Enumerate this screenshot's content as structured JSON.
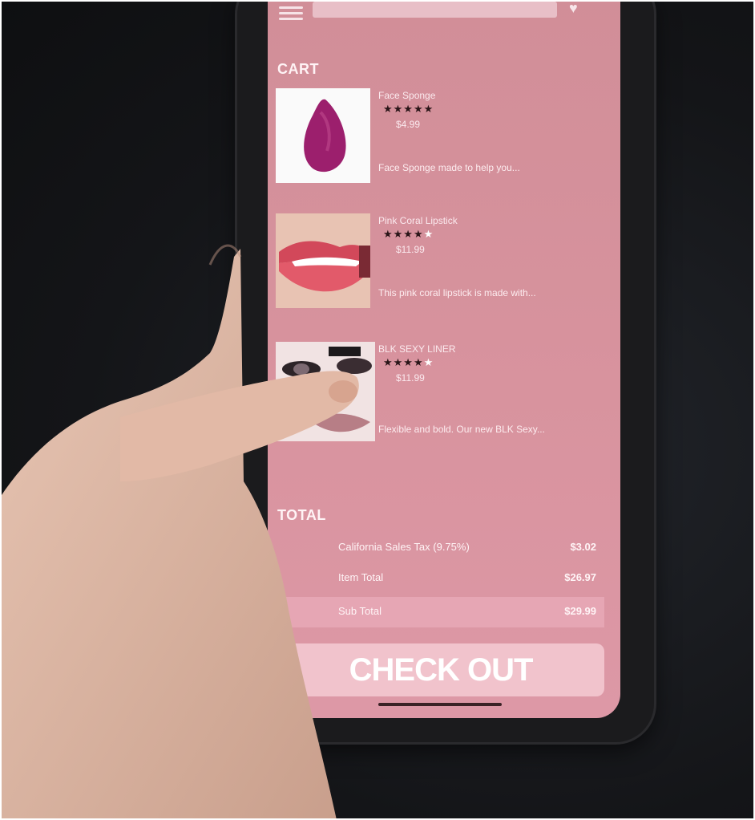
{
  "cart": {
    "title": "CART",
    "items": [
      {
        "name": "Face Sponge",
        "stars": "★★★★★",
        "empty_stars": "",
        "price": "$4.99",
        "description": "Face Sponge made to help you..."
      },
      {
        "name": "Pink Coral Lipstick",
        "stars": "★★★★",
        "empty_stars": "★",
        "price": "$11.99",
        "description": "This pink coral lipstick is made with..."
      },
      {
        "name": "BLK SEXY LINER",
        "stars": "★★★★",
        "empty_stars": "★",
        "price": "$11.99",
        "description": "Flexible and bold. Our new BLK Sexy..."
      }
    ]
  },
  "totals": {
    "title": "TOTAL",
    "rows": [
      {
        "label": "California Sales Tax (9.75%)",
        "value": "$3.02"
      },
      {
        "label": "Item Total",
        "value": "$26.97"
      },
      {
        "label": "Sub Total",
        "value": "$29.99"
      }
    ]
  },
  "checkout_label": "CHECK OUT",
  "icons": {
    "menu": "hamburger-menu-icon",
    "cart": "cart-icon"
  },
  "colors": {
    "screen_bg": "#d8939e",
    "button_bg": "#f1c3cc",
    "accent": "#e6a6b4"
  }
}
